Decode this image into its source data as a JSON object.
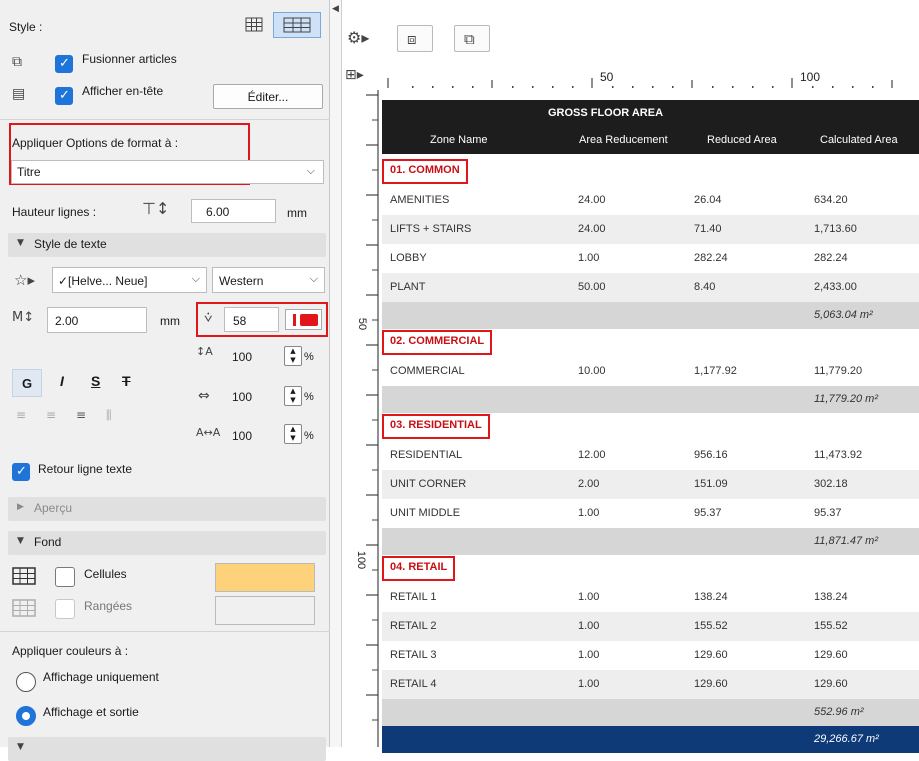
{
  "left_panel": {
    "style_label": "Style :",
    "merge_label": "Fusionner articles",
    "header_label": "Afficher en-tête",
    "edit_button": "Éditer...",
    "apply_format_label": "Appliquer Options de format à :",
    "apply_format_value": "Titre",
    "row_height_label": "Hauteur lignes :",
    "row_height_value": "6.00",
    "row_height_unit": "mm",
    "text_style_section": "Style de texte",
    "font_value": "✓[Helve... Neue]",
    "script_value": "Western",
    "font_size_value": "2.00",
    "font_size_unit": "mm",
    "pen_value": "58",
    "bold": "G",
    "italic": "I",
    "underline": "S",
    "strike": "T",
    "scale_height": "100",
    "scale_width": "100",
    "scale_spacing": "100",
    "percent": "%",
    "wrap_label": "Retour ligne texte",
    "preview_section": "Aperçu",
    "background_section": "Fond",
    "cells_label": "Cellules",
    "rows_label": "Rangées",
    "cells_color": "#fdd27a",
    "apply_colors_label": "Appliquer couleurs à :",
    "display_only": "Affichage uniquement",
    "display_output": "Affichage et sortie"
  },
  "ruler": {
    "mark_50": "50",
    "mark_100": "100",
    "vmark_50": "50",
    "vmark_100": "100"
  },
  "table": {
    "title": "GROSS FLOOR AREA",
    "columns": [
      "Zone Name",
      "Area Reducement",
      "Reduced Area",
      "Calculated Area"
    ],
    "groups": [
      {
        "zone": "01. COMMON",
        "rows": [
          [
            "AMENITIES",
            "24.00",
            "26.04",
            "634.20"
          ],
          [
            "LIFTS + STAIRS",
            "24.00",
            "71.40",
            "1,713.60"
          ],
          [
            "LOBBY",
            "1.00",
            "282.24",
            "282.24"
          ],
          [
            "PLANT",
            "50.00",
            "8.40",
            "2,433.00"
          ]
        ],
        "subtotal": "5,063.04 m²"
      },
      {
        "zone": "02. COMMERCIAL",
        "rows": [
          [
            "COMMERCIAL",
            "10.00",
            "1,177.92",
            "11,779.20"
          ]
        ],
        "subtotal": "11,779.20 m²"
      },
      {
        "zone": "03. RESIDENTIAL",
        "rows": [
          [
            "RESIDENTIAL",
            "12.00",
            "956.16",
            "11,473.92"
          ],
          [
            "UNIT CORNER",
            "2.00",
            "151.09",
            "302.18"
          ],
          [
            "UNIT MIDDLE",
            "1.00",
            "95.37",
            "95.37"
          ]
        ],
        "subtotal": "11,871.47 m²"
      },
      {
        "zone": "04. RETAIL",
        "rows": [
          [
            "RETAIL 1",
            "1.00",
            "138.24",
            "138.24"
          ],
          [
            "RETAIL 2",
            "1.00",
            "155.52",
            "155.52"
          ],
          [
            "RETAIL 3",
            "1.00",
            "129.60",
            "129.60"
          ],
          [
            "RETAIL 4",
            "1.00",
            "129.60",
            "129.60"
          ]
        ],
        "subtotal": "552.96 m²"
      }
    ],
    "grand_total": "29,266.67 m²"
  }
}
